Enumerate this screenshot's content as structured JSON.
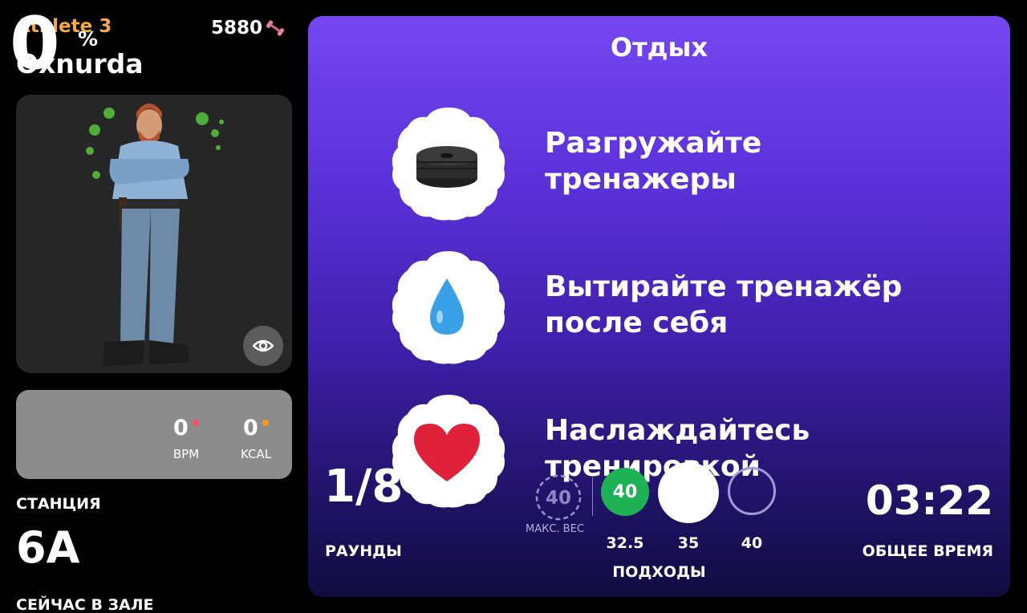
{
  "athlete": {
    "name": "Athlete 3",
    "points": "5880",
    "username": "Oxnurda"
  },
  "stats": {
    "percent": "0",
    "percent_sign": "%",
    "bpm_value": "0",
    "bpm_label": "BPM",
    "kcal_value": "0",
    "kcal_label": "KCAL"
  },
  "station": {
    "label": "СТАНЦИЯ",
    "value": "6A"
  },
  "now_in_gym_label": "СЕЙЧАС В ЗАЛЕ",
  "panel": {
    "title": "Отдых",
    "tips": [
      {
        "line1": "Разгружайте",
        "line2": "тренажеры",
        "icon": "weight-plates-icon"
      },
      {
        "line1": "Вытирайте тренажёр",
        "line2": "после себя",
        "icon": "water-drop-icon"
      },
      {
        "line1": "Наслаждайтесь",
        "line2": "тренировкой",
        "icon": "heart-icon"
      }
    ]
  },
  "rounds": {
    "value": "1/8",
    "label": "РАУНДЫ"
  },
  "sets": {
    "max_weight_value": "40",
    "max_weight_label": "МАКС. ВЕС",
    "done_value": "40",
    "weights": [
      "32.5",
      "35",
      "40"
    ],
    "label": "ПОДХОДЫ"
  },
  "total_time": {
    "value": "03:22",
    "label": "ОБЩЕЕ ВРЕМЯ"
  },
  "colors": {
    "accent_orange": "#f5a94c",
    "panel_purple": "#7547f0",
    "done_green": "#1eb254",
    "heart_red": "#e0213a",
    "kcal_orange": "#f59a1b"
  }
}
